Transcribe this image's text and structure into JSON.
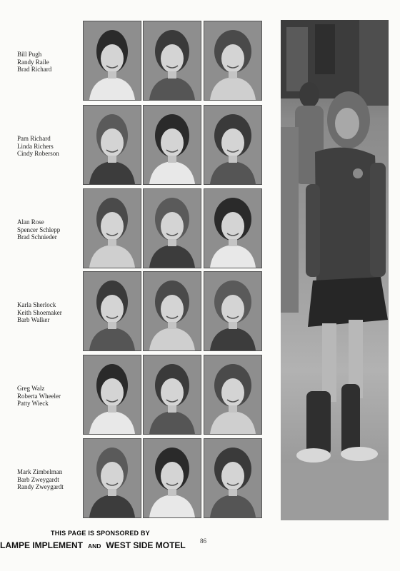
{
  "rows": [
    {
      "names": [
        "Bill Pugh",
        "Randy Raile",
        "Brad Richard"
      ]
    },
    {
      "names": [
        "Pam Richard",
        "Linda Richers",
        "Cindy Roberson"
      ]
    },
    {
      "names": [
        "Alan Rose",
        "Spencer Schlepp",
        "Brad Schnieder"
      ]
    },
    {
      "names": [
        "Karla Sherlock",
        "Keith Shoemaker",
        "Barb Walker"
      ]
    },
    {
      "names": [
        "Greg Walz",
        "Roberta Wheeler",
        "Patty Wieck"
      ]
    },
    {
      "names": [
        "Mark Zimbelman",
        "Barb Zweygardt",
        "Randy Zweygardt"
      ]
    }
  ],
  "sponsor": {
    "line": "THIS PAGE IS SPONSORED BY",
    "first": "LAMPE IMPLEMENT",
    "and": "AND",
    "second": "WEST SIDE MOTEL"
  },
  "page_number": "86"
}
